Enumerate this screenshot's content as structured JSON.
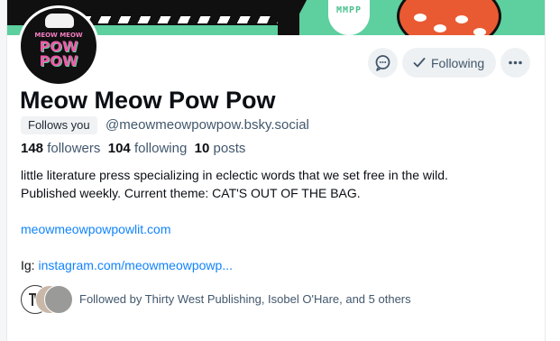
{
  "banner": {
    "badge_text": "MMPP"
  },
  "avatar": {
    "line1": "MEOW MEOW",
    "line2": "POW POW"
  },
  "actions": {
    "following_label": "Following"
  },
  "profile": {
    "display_name": "Meow Meow Pow Pow",
    "follows_you": "Follows you",
    "handle": "@meowmeowpowpow.bsky.social",
    "followers_count": "148",
    "followers_label": "followers",
    "following_count": "104",
    "following_label": "following",
    "posts_count": "10",
    "posts_label": "posts"
  },
  "bio": {
    "line1": "little literature press specializing in eclectic words that we set free in the wild.",
    "line2": "Published weekly. Current theme: CAT'S OUT OF THE BAG.",
    "website": "meowmeowpowpowlit.com",
    "ig_prefix": "Ig: ",
    "ig_link": "instagram.com/meowmeowpowp..."
  },
  "known_followers": {
    "text": "Followed by Thirty West Publishing, Isobel O'Hare, and 5 others"
  },
  "colors": {
    "accent": "#1083fe",
    "banner": "#5ecf9f",
    "muted": "#42576c"
  },
  "icons": [
    "message-icon",
    "checkmark-icon",
    "more-icon"
  ]
}
